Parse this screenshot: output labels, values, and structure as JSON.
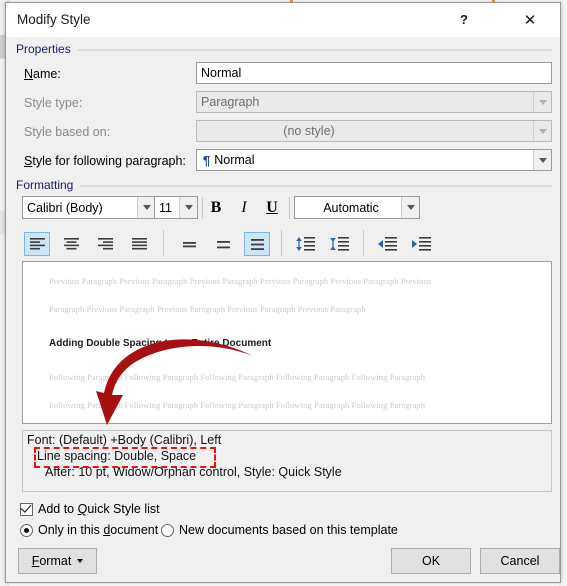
{
  "window": {
    "title": "Modify Style",
    "help_button": "?",
    "close_button": "✕"
  },
  "properties": {
    "group_label": "Properties",
    "name_label": "Name:",
    "name_value": "Normal",
    "style_type_label": "Style type:",
    "style_type_value": "Paragraph",
    "style_based_on_label": "Style based on:",
    "style_based_on_value": "(no style)",
    "style_following_label": "Style for following paragraph:",
    "style_following_value": "Normal",
    "style_following_icon": "pilcrow-icon"
  },
  "formatting": {
    "group_label": "Formatting",
    "font_family": "Calibri (Body)",
    "font_size": "11",
    "bold": "B",
    "italic": "I",
    "underline": "U",
    "font_color": "Automatic",
    "align_buttons": [
      {
        "name": "align-left",
        "label": "Align Left",
        "active": true
      },
      {
        "name": "align-center",
        "label": "Center",
        "active": false
      },
      {
        "name": "align-right",
        "label": "Align Right",
        "active": false
      },
      {
        "name": "align-justify",
        "label": "Justify",
        "active": false
      }
    ],
    "spacing_buttons": [
      {
        "name": "line-spacing-single",
        "label": "Single Spacing",
        "active": false
      },
      {
        "name": "line-spacing-1-5",
        "label": "1.5 Spacing",
        "active": false
      },
      {
        "name": "line-spacing-double",
        "label": "Double Spacing",
        "active": true
      }
    ],
    "paragraph_spacing_buttons": [
      {
        "name": "decrease-paragraph-spacing",
        "label": "Decrease Paragraph Spacing"
      },
      {
        "name": "increase-paragraph-spacing",
        "label": "Increase Paragraph Spacing"
      }
    ],
    "indent_buttons": [
      {
        "name": "decrease-indent",
        "label": "Decrease Indent"
      },
      {
        "name": "increase-indent",
        "label": "Increase Indent"
      }
    ]
  },
  "preview": {
    "previous_line_1": "Previous Paragraph Previous Paragraph Previous Paragraph Previous Paragraph Previous Paragraph Previous",
    "previous_line_2": "Paragraph Previous Paragraph Previous Paragraph Previous Paragraph Previous Paragraph",
    "sample_text": "Adding Double Spacing to an Entire Document",
    "following_line_1": "Following Paragraph Following Paragraph Following Paragraph Following Paragraph Following Paragraph",
    "following_line_2": "Following Paragraph Following Paragraph Following Paragraph Following Paragraph Following Paragraph"
  },
  "description": {
    "line1": "Font: (Default) +Body (Calibri), Left",
    "line2": "Line spacing:  Double, Space",
    "line3": "After:  10 pt, Widow/Orphan control, Style: Quick Style"
  },
  "options": {
    "add_to_quick_style": "Add to Quick Style list",
    "add_to_quick_style_checked": true,
    "only_this_document": "Only in this document",
    "only_this_document_selected": true,
    "new_documents_template": "New documents based on this template",
    "new_documents_template_selected": false
  },
  "footer": {
    "format_button": "Format",
    "ok_button": "OK",
    "cancel_button": "Cancel"
  },
  "annotation": {
    "arrow_color": "#a81010",
    "highlight_color": "#ee1111",
    "highlight_target": "Line spacing:  Double, Space"
  }
}
